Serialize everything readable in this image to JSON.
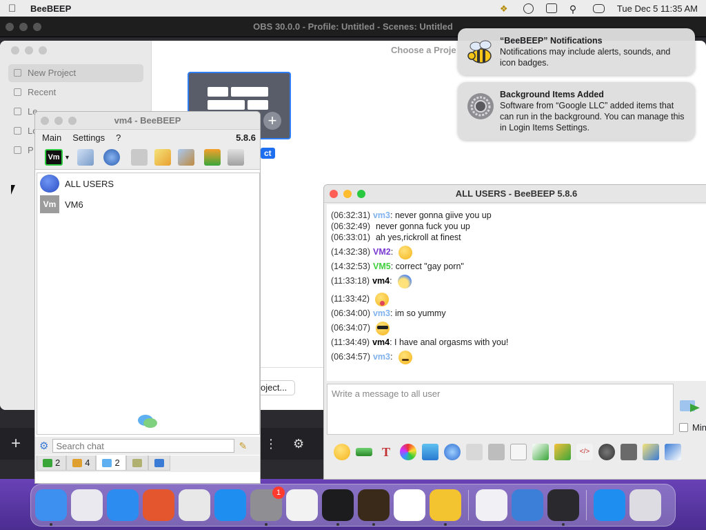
{
  "menubar": {
    "app_name": "BeeBEEP",
    "clock": "Tue Dec 5  11:35 AM"
  },
  "obs": {
    "title": "OBS 30.0.0 - Profile: Untitled - Scenes: Untitled"
  },
  "chooser": {
    "title": "Choose a Proje",
    "sidebar": [
      {
        "label": "New Project"
      },
      {
        "label": "Recent"
      },
      {
        "label": "Le"
      },
      {
        "label": "Lo"
      },
      {
        "label": "P"
      }
    ],
    "template_label": "ct",
    "button": "oject..."
  },
  "notifications": [
    {
      "title": "“BeeBEEP” Notifications",
      "body": "Notifications may include alerts, sounds, and icon badges."
    },
    {
      "title": "Background Items Added",
      "body": "Software from “Google LLC” added items that can run in the background. You can manage this in Login Items Settings."
    }
  ],
  "bee_main": {
    "title": "vm4 - BeeBEEP",
    "menu": [
      "Main",
      "Settings",
      "?"
    ],
    "version": "5.8.6",
    "users": [
      {
        "name": "ALL USERS",
        "avatar": "all-users"
      },
      {
        "name": "VM6",
        "avatar": "Vm"
      }
    ],
    "vm_badge": "Vm",
    "search_placeholder": "Search chat",
    "tabs": [
      {
        "count": "2",
        "icon": "chat-list-icon"
      },
      {
        "count": "4",
        "icon": "users-icon"
      },
      {
        "count": "2",
        "icon": "chats-icon"
      },
      {
        "count": "",
        "icon": "groups-icon"
      },
      {
        "count": "",
        "icon": "files-icon"
      }
    ]
  },
  "chat": {
    "title": "ALL USERS - BeeBEEP 5.8.6",
    "messages": [
      {
        "ts": "(06:32:31)",
        "nick": "vm3",
        "color": "#7fb2ee",
        "text": ": never gonna giive you up",
        "emoji": ""
      },
      {
        "ts": "(06:32:49)",
        "nick": "",
        "color": "",
        "text": "never gonna fuck you up",
        "emoji": ""
      },
      {
        "ts": "(06:33:01)",
        "nick": "",
        "color": "",
        "text": "ah yes,rickroll at finest",
        "emoji": ""
      },
      {
        "ts": "(14:32:38)",
        "nick": "VM2",
        "color": "#7a3ad1",
        "text": ":",
        "emoji": "flushed"
      },
      {
        "ts": "(14:32:53)",
        "nick": "VM5",
        "color": "#3fcf3a",
        "text": ": correct \"gay porn\"",
        "emoji": ""
      },
      {
        "ts": "(11:33:18)",
        "nick": "vm4",
        "color": "#000000",
        "text": ":",
        "emoji": "cold"
      },
      {
        "ts": "(11:33:42)",
        "nick": "",
        "color": "",
        "text": "",
        "emoji": "tongue"
      },
      {
        "ts": "(06:34:00)",
        "nick": "vm3",
        "color": "#7fb2ee",
        "text": ": im so yummy",
        "emoji": ""
      },
      {
        "ts": "(06:34:07)",
        "nick": "",
        "color": "",
        "text": "",
        "emoji": "cool"
      },
      {
        "ts": "(11:34:49)",
        "nick": "vm4",
        "color": "#000000",
        "text": ": I have anal orgasms with you!",
        "emoji": ""
      },
      {
        "ts": "(06:34:57)",
        "nick": "vm3",
        "color": "#7fb2ee",
        "text": ":",
        "emoji": "worry"
      }
    ],
    "input_placeholder": "Write a message to all user",
    "min_label": "Min"
  },
  "dock": [
    {
      "name": "finder-icon",
      "color": "#3d8ff0",
      "running": true
    },
    {
      "name": "launchpad-icon",
      "color": "#e9e9ef",
      "running": false
    },
    {
      "name": "safari-icon",
      "color": "#2d8cf0",
      "running": false
    },
    {
      "name": "firefox-icon",
      "color": "#e4572e",
      "running": false
    },
    {
      "name": "chrome-icon",
      "color": "#e8e8e8",
      "running": false
    },
    {
      "name": "app-store-icon",
      "color": "#1f8ef1",
      "running": false
    },
    {
      "name": "system-settings-icon",
      "color": "#8e8e93",
      "running": true,
      "badge": "1"
    },
    {
      "name": "textedit-icon",
      "color": "#f2f2f2",
      "running": false
    },
    {
      "name": "terminal-icon",
      "color": "#1c1c1e",
      "running": true
    },
    {
      "name": "garageband-icon",
      "color": "#3a2a1a",
      "running": true
    },
    {
      "name": "vscode-icon",
      "color": "#ffffff",
      "running": false
    },
    {
      "name": "beebeep-icon",
      "color": "#f4c430",
      "running": true
    },
    {
      "name": "visual-studio-icon",
      "color": "#f0f0f5",
      "running": false
    },
    {
      "name": "weather-icon",
      "color": "#3c7fd8",
      "running": false
    },
    {
      "name": "obs-icon",
      "color": "#2a2a2e",
      "running": true
    },
    {
      "name": "app-store-2-icon",
      "color": "#1f8ef1",
      "running": false
    },
    {
      "name": "trash-icon",
      "color": "#dcdce2",
      "running": false
    }
  ]
}
